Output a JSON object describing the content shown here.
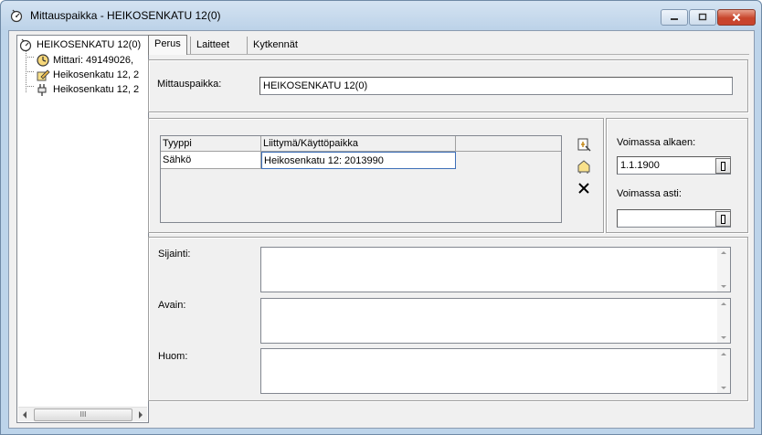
{
  "window": {
    "title": "Mittauspaikka - HEIKOSENKATU 12(0)",
    "title_icon": "meter-point-icon"
  },
  "tree": {
    "root": {
      "label": "HEIKOSENKATU 12(0)",
      "icon": "meter-point-icon"
    },
    "children": [
      {
        "label": "Mittari: 49149026,",
        "icon": "meter-clock-icon"
      },
      {
        "label": "Heikosenkatu 12, 2",
        "icon": "connection-edit-icon"
      },
      {
        "label": "Heikosenkatu 12, 2",
        "icon": "connection-plug-icon"
      }
    ],
    "scroll_thumb": "III"
  },
  "tabs": [
    {
      "label": "Perus",
      "active": true
    },
    {
      "label": "Laitteet",
      "active": false
    },
    {
      "label": "Kytkennät",
      "active": false
    }
  ],
  "mittauspaikka": {
    "label": "Mittauspaikka:",
    "value": "HEIKOSENKATU 12(0)"
  },
  "grid": {
    "columns": [
      "Tyyppi",
      "Liittymä/Käyttöpaikka"
    ],
    "rows": [
      [
        "Sähkö",
        "Heikosenkatu 12: 2013990"
      ]
    ],
    "buttons": [
      "link-connection-icon",
      "new-connection-icon",
      "delete-icon"
    ]
  },
  "validity": {
    "from_label": "Voimassa alkaen:",
    "from_value": "1.1.1900",
    "to_label": "Voimassa asti:",
    "to_value": ""
  },
  "notes": {
    "sijainti_label": "Sijainti:",
    "avain_label": "Avain:",
    "huom_label": "Huom:"
  },
  "colors": {
    "titlebar": "#bcd2e8",
    "close_button": "#c8452c",
    "form_background": "#f0f0f0",
    "selection_border": "#3d6fb8"
  }
}
